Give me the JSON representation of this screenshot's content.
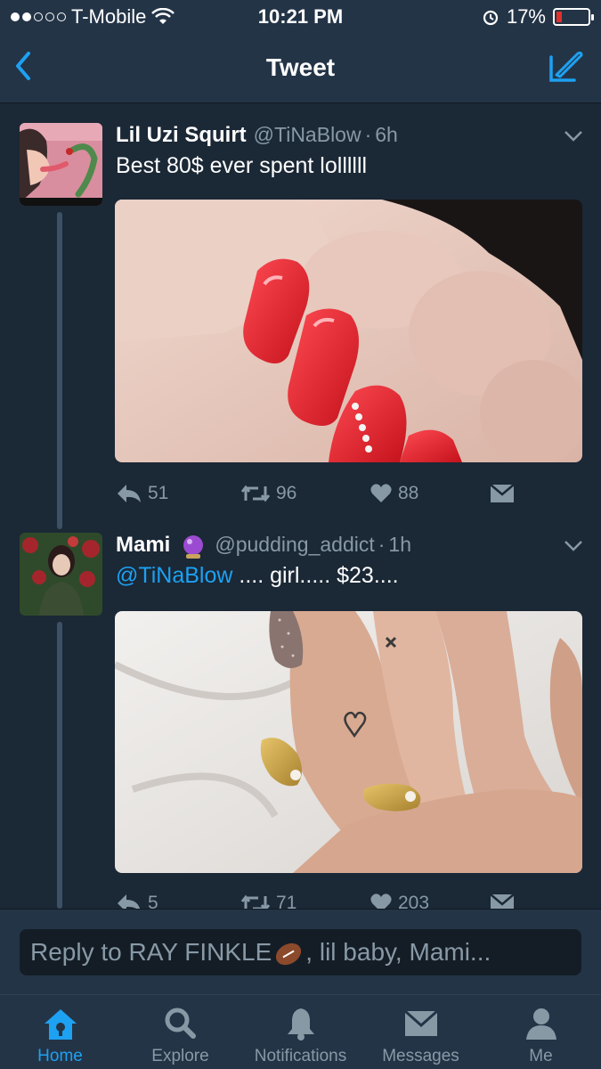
{
  "status_bar": {
    "carrier": "T-Mobile",
    "time": "10:21 PM",
    "battery": "17%",
    "battery_level": 0.17,
    "signal_bars": 2,
    "signal_total": 5
  },
  "nav": {
    "title": "Tweet",
    "back_icon": "chevron-left-icon",
    "compose_icon": "compose-icon",
    "accent": "#1da1f2"
  },
  "tweets": [
    {
      "name": "Lil Uzi Squirt",
      "handle": "@TiNaBlow",
      "sep": "·",
      "time": "6h",
      "text": "Best 80$ ever spent lollllll",
      "replies": "51",
      "retweets": "96",
      "likes": "88"
    },
    {
      "name": "Mami",
      "emoji": "crystal-ball-icon",
      "handle": "@pudding_addict",
      "sep": "·",
      "time": "1h",
      "mention": "@TiNaBlow",
      "text": " .... girl..... $23....",
      "replies": "5",
      "retweets": "71",
      "likes": "203"
    }
  ],
  "reply": {
    "placeholder_before": "Reply to RAY FINKLE",
    "placeholder_after": ", lil baby, Mami..."
  },
  "tabs": [
    {
      "label": "Home",
      "icon": "home-icon",
      "active": true
    },
    {
      "label": "Explore",
      "icon": "search-icon",
      "active": false
    },
    {
      "label": "Notifications",
      "icon": "bell-icon",
      "active": false
    },
    {
      "label": "Messages",
      "icon": "envelope-icon",
      "active": false
    },
    {
      "label": "Me",
      "icon": "person-icon",
      "active": false
    }
  ]
}
